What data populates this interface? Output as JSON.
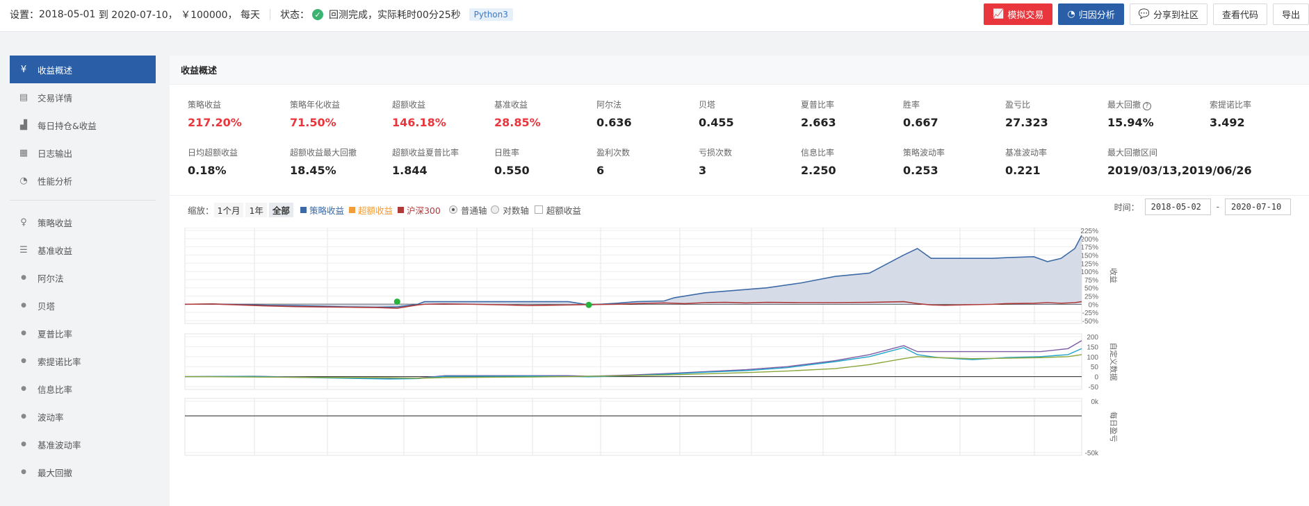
{
  "topbar": {
    "settings_label": "设置：",
    "date_from": "2018-05-01",
    "to_word": "到",
    "date_to": "2020-07-10，",
    "capital": "￥100000，",
    "frequency": "每天",
    "status_label": "状态：",
    "status_text": "回测完成，实际耗时00分25秒",
    "lang_badge": "Python3",
    "buttons": {
      "simulate": "模拟交易",
      "attribution": "归因分析",
      "share": "分享到社区",
      "view_code": "查看代码",
      "export": "导出"
    }
  },
  "sidebar": {
    "items": [
      {
        "label": "收益概述",
        "icon": "yen-circle-icon"
      },
      {
        "label": "交易详情",
        "icon": "document-icon"
      },
      {
        "label": "每日持仓&收益",
        "icon": "bar-chart-icon"
      },
      {
        "label": "日志输出",
        "icon": "calendar-icon"
      },
      {
        "label": "性能分析",
        "icon": "pie-icon"
      },
      {
        "label": "策略收益",
        "icon": "lightbulb-icon"
      },
      {
        "label": "基准收益",
        "icon": "database-icon"
      },
      {
        "label": "阿尔法",
        "icon": "bullet-icon"
      },
      {
        "label": "贝塔",
        "icon": "bullet-icon"
      },
      {
        "label": "夏普比率",
        "icon": "bullet-icon"
      },
      {
        "label": "索提诺比率",
        "icon": "bullet-icon"
      },
      {
        "label": "信息比率",
        "icon": "bullet-icon"
      },
      {
        "label": "波动率",
        "icon": "bullet-icon"
      },
      {
        "label": "基准波动率",
        "icon": "bullet-icon"
      },
      {
        "label": "最大回撤",
        "icon": "bullet-icon"
      }
    ]
  },
  "overview": {
    "title": "收益概述",
    "metrics_row1": [
      {
        "label": "策略收益",
        "value": "217.20%",
        "color": "#e8363c"
      },
      {
        "label": "策略年化收益",
        "value": "71.50%",
        "color": "#e8363c"
      },
      {
        "label": "超额收益",
        "value": "146.18%",
        "color": "#e8363c"
      },
      {
        "label": "基准收益",
        "value": "28.85%",
        "color": "#e8363c"
      },
      {
        "label": "阿尔法",
        "value": "0.636"
      },
      {
        "label": "贝塔",
        "value": "0.455"
      },
      {
        "label": "夏普比率",
        "value": "2.663"
      },
      {
        "label": "胜率",
        "value": "0.667"
      },
      {
        "label": "盈亏比",
        "value": "27.323"
      },
      {
        "label": "最大回撤",
        "value": "15.94%"
      },
      {
        "label": "索提诺比率",
        "value": "3.492"
      }
    ],
    "metrics_row2": [
      {
        "label": "日均超额收益",
        "value": "0.18%"
      },
      {
        "label": "超额收益最大回撤",
        "value": "18.45%"
      },
      {
        "label": "超额收益夏普比率",
        "value": "1.844"
      },
      {
        "label": "日胜率",
        "value": "0.550"
      },
      {
        "label": "盈利次数",
        "value": "6"
      },
      {
        "label": "亏损次数",
        "value": "3"
      },
      {
        "label": "信息比率",
        "value": "2.250"
      },
      {
        "label": "策略波动率",
        "value": "0.253"
      },
      {
        "label": "基准波动率",
        "value": "0.221"
      },
      {
        "label": "最大回撤区间",
        "value": "2019/03/13,2019/06/26"
      }
    ]
  },
  "controls": {
    "zoom_label": "缩放：",
    "zoom_1m": "1个月",
    "zoom_1y": "1年",
    "zoom_all": "全部",
    "legend_strategy": "策略收益",
    "legend_excess": "超额收益",
    "legend_hs300": "沪深300",
    "axis_normal": "普通轴",
    "axis_log": "对数轴",
    "excess_checkbox": "超额收益",
    "time_label": "时间：",
    "time_start": "2018-05-02",
    "time_dash": "-",
    "time_end": "2020-07-10"
  },
  "colors": {
    "strategy": "#3d6aa6",
    "excess": "#f39c3a",
    "hs300": "#b03a3a",
    "active_nav": "#2a5fa8",
    "buy_dot": "#27b33c"
  },
  "chart_data": [
    {
      "type": "area",
      "ylabel": "收益",
      "yticks": [
        "225%",
        "200%",
        "175%",
        "150%",
        "125%",
        "100%",
        "75%",
        "50%",
        "25%",
        "0%",
        "-25%",
        "-50%"
      ],
      "ylim": [
        -50,
        225
      ],
      "x": [
        0,
        40,
        80,
        120,
        160,
        200,
        240,
        280,
        310,
        340,
        350,
        380,
        420,
        470,
        500,
        530,
        560,
        590,
        630,
        660,
        700,
        715,
        730,
        760,
        790,
        820,
        850,
        900,
        950,
        1000,
        1050,
        1070,
        1090,
        1110,
        1180,
        1200,
        1240,
        1260,
        1280,
        1300,
        1310
      ],
      "series": [
        {
          "name": "策略收益",
          "values": [
            0,
            1,
            -1,
            -3,
            -4,
            -6,
            -8,
            -9,
            -8,
            0,
            8,
            8,
            8,
            8,
            8,
            8,
            8,
            -2,
            3,
            8,
            10,
            20,
            25,
            35,
            40,
            45,
            50,
            65,
            85,
            95,
            150,
            170,
            140,
            140,
            140,
            142,
            145,
            130,
            140,
            170,
            210
          ]
        },
        {
          "name": "沪深300",
          "values": [
            0,
            1,
            -2,
            -5,
            -7,
            -8,
            -9,
            -10,
            -12,
            -2,
            0,
            1,
            0,
            -2,
            -4,
            -3,
            -2,
            -1,
            0,
            2,
            4,
            3,
            2,
            5,
            6,
            4,
            6,
            5,
            5,
            6,
            8,
            2,
            -2,
            -3,
            0,
            2,
            3,
            5,
            3,
            5,
            8
          ]
        }
      ],
      "markers": [
        {
          "x": 310,
          "y": 8
        },
        {
          "x": 590,
          "y": -2
        }
      ]
    },
    {
      "type": "line",
      "ylabel": "自定义数据",
      "yticks": [
        "200",
        "150",
        "100",
        "50",
        "0",
        "-50"
      ],
      "ylim": [
        -50,
        200
      ],
      "x": [
        0,
        100,
        200,
        300,
        340,
        380,
        450,
        500,
        560,
        590,
        650,
        700,
        760,
        820,
        880,
        950,
        1000,
        1050,
        1070,
        1100,
        1150,
        1200,
        1250,
        1290,
        1310
      ],
      "series": [
        {
          "name": "",
          "values": [
            0,
            2,
            -5,
            -10,
            -8,
            5,
            5,
            5,
            5,
            2,
            8,
            15,
            25,
            35,
            50,
            80,
            110,
            155,
            125,
            125,
            125,
            125,
            125,
            140,
            180
          ]
        },
        {
          "name": "",
          "values": [
            0,
            1,
            -6,
            -12,
            -10,
            2,
            2,
            3,
            1,
            -1,
            5,
            12,
            22,
            30,
            45,
            75,
            100,
            145,
            110,
            95,
            85,
            95,
            100,
            110,
            140
          ]
        },
        {
          "name": "",
          "values": [
            0,
            -2,
            -4,
            -6,
            -8,
            -5,
            -3,
            -2,
            0,
            2,
            5,
            8,
            14,
            20,
            28,
            40,
            60,
            90,
            100,
            95,
            90,
            92,
            95,
            100,
            110
          ]
        }
      ]
    },
    {
      "type": "bar",
      "ylabel": "每日盈亏",
      "yticks": [
        "0k",
        "-50k"
      ],
      "ylim": [
        -50,
        20
      ]
    }
  ]
}
